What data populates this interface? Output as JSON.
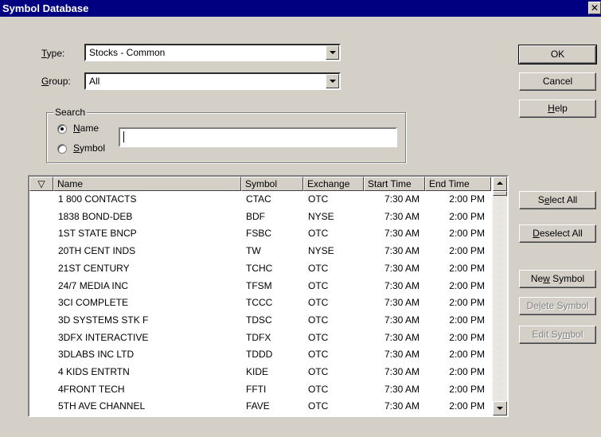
{
  "window": {
    "title": "Symbol Database",
    "close_glyph": "✕"
  },
  "type": {
    "label_prefix": "",
    "label_u": "T",
    "label_rest": "ype:",
    "value": "Stocks - Common"
  },
  "group": {
    "label_u": "G",
    "label_rest": "roup:",
    "value": "All"
  },
  "search": {
    "legend": "Search",
    "name_label_u": "N",
    "name_label_rest": "ame",
    "symbol_label_u": "S",
    "symbol_label_rest": "ymbol",
    "selected": "name",
    "text": ""
  },
  "buttons": {
    "ok": "OK",
    "cancel": "Cancel",
    "help_u": "H",
    "help_rest": "elp",
    "select_all_pre": "S",
    "select_all_u": "e",
    "select_all_rest": "lect All",
    "deselect_all_u": "D",
    "deselect_all_rest": "eselect All",
    "new_symbol_pre": "Ne",
    "new_symbol_u": "w",
    "new_symbol_rest": " Symbol",
    "delete_symbol_pre": "De",
    "delete_symbol_u": "l",
    "delete_symbol_rest": "ete Symbol",
    "edit_symbol_pre": "Edit Sy",
    "edit_symbol_u": "m",
    "edit_symbol_rest": "bol"
  },
  "table": {
    "filter_icon": "▽",
    "columns": [
      "Name",
      "Symbol",
      "Exchange",
      "Start Time",
      "End Time"
    ],
    "rows": [
      [
        "1 800 CONTACTS",
        "CTAC",
        "OTC",
        "7:30 AM",
        "2:00 PM"
      ],
      [
        "1838 BOND-DEB",
        "BDF",
        "NYSE",
        "7:30 AM",
        "2:00 PM"
      ],
      [
        "1ST STATE BNCP",
        "FSBC",
        "OTC",
        "7:30 AM",
        "2:00 PM"
      ],
      [
        "20TH CENT INDS",
        "TW",
        "NYSE",
        "7:30 AM",
        "2:00 PM"
      ],
      [
        "21ST CENTURY",
        "TCHC",
        "OTC",
        "7:30 AM",
        "2:00 PM"
      ],
      [
        "24/7 MEDIA INC",
        "TFSM",
        "OTC",
        "7:30 AM",
        "2:00 PM"
      ],
      [
        "3CI COMPLETE",
        "TCCC",
        "OTC",
        "7:30 AM",
        "2:00 PM"
      ],
      [
        "3D SYSTEMS STK F",
        "TDSC",
        "OTC",
        "7:30 AM",
        "2:00 PM"
      ],
      [
        "3DFX INTERACTIVE",
        "TDFX",
        "OTC",
        "7:30 AM",
        "2:00 PM"
      ],
      [
        "3DLABS INC LTD",
        "TDDD",
        "OTC",
        "7:30 AM",
        "2:00 PM"
      ],
      [
        "4 KIDS ENTRTN",
        "KIDE",
        "OTC",
        "7:30 AM",
        "2:00 PM"
      ],
      [
        "4FRONT TECH",
        "FFTI",
        "OTC",
        "7:30 AM",
        "2:00 PM"
      ],
      [
        "5TH AVE CHANNEL",
        "FAVE",
        "OTC",
        "7:30 AM",
        "2:00 PM"
      ]
    ]
  }
}
